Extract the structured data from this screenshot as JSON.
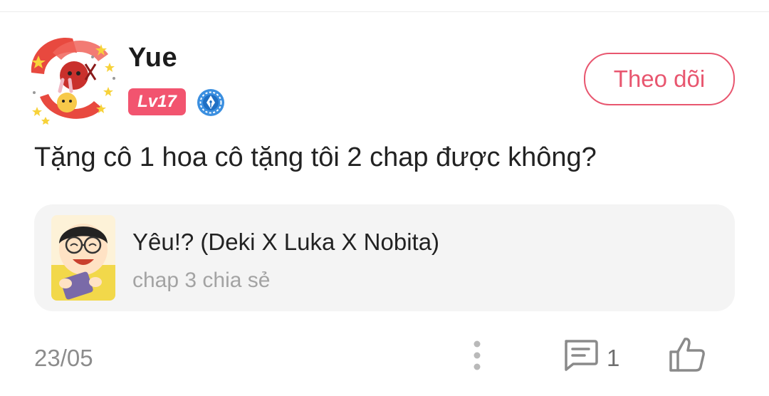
{
  "comment": {
    "author": {
      "name": "Yue",
      "level": "Lv17"
    },
    "follow_label": "Theo dõi",
    "text": "Tặng cô 1 hoa cô tặng tôi 2 chap được không?",
    "shared_item": {
      "title": "Yêu!? (Deki X Luka X Nobita)",
      "subtitle": "chap 3 chia sẻ"
    },
    "date": "23/05",
    "reply_count": "1"
  },
  "colors": {
    "accent": "#e8566f",
    "level_badge": "#f2546f",
    "card_background": "#f4f4f4",
    "muted_text": "#a3a3a3"
  },
  "icons": {
    "pen_badge": "fountain-pen-badge-icon",
    "more": "more-vertical-icon",
    "comment": "comment-icon",
    "like": "thumbs-up-icon"
  }
}
